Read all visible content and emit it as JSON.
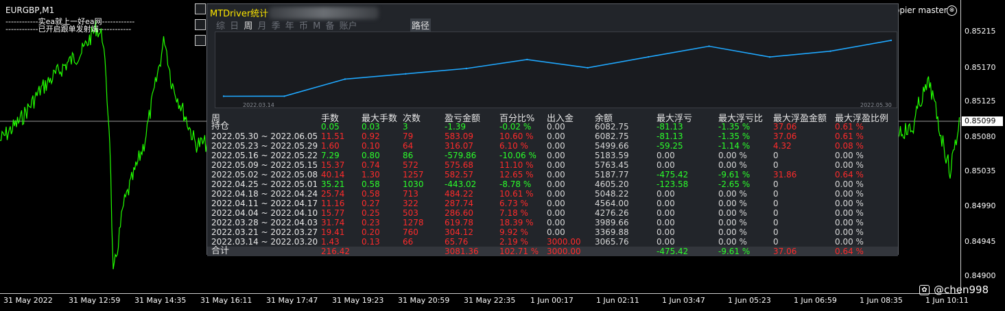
{
  "symbol_title": "EURGBP,M1",
  "comments": [
    "------------实ea就上一好ea网------------",
    "------------已开启跟单发射端------------"
  ],
  "copier": {
    "label": "opier master",
    "close_icon": "⊗"
  },
  "price_axis": {
    "labels": [
      "0.85215",
      "0.85170",
      "0.85125",
      "0.85080",
      "0.85035",
      "0.84990",
      "0.84945",
      "0.84900"
    ],
    "current": "0.85099",
    "range": [
      0.849,
      0.85215
    ]
  },
  "time_axis": [
    "31 May 2022",
    "31 May 12:59",
    "31 May 14:35",
    "31 May 16:11",
    "31 May 17:47",
    "31 May 19:23",
    "31 May 20:59",
    "31 May 22:35",
    "1 Jun 00:17",
    "1 Jun 02:11",
    "1 Jun 03:47",
    "1 Jun 05:23",
    "1 Jun 06:59",
    "1 Jun 08:35",
    "1 Jun 10:11"
  ],
  "watermark": "@chen998",
  "panel": {
    "title": "MTDriver统计",
    "tabs": [
      {
        "label": "综",
        "active": false
      },
      {
        "label": "日",
        "active": false
      },
      {
        "label": "周",
        "active": true
      },
      {
        "label": "月",
        "active": false
      },
      {
        "label": "季",
        "active": false
      },
      {
        "label": "年",
        "active": false
      },
      {
        "label": "币",
        "active": false
      },
      {
        "label": "M",
        "active": false
      },
      {
        "label": "备",
        "active": false
      },
      {
        "label": "账户",
        "active": false
      }
    ],
    "path_tab": "路径",
    "equity": {
      "start_date": "2022.03.14",
      "end_date": "2022.05.30",
      "values": [
        3065.76,
        3069.76,
        3989.66,
        4276.26,
        4564.0,
        5048.22,
        4605.2,
        5187.77,
        5763.45,
        5183.59,
        5499.66,
        6082.75
      ],
      "range": [
        2900,
        6300
      ]
    },
    "headers": [
      "周",
      "手数",
      "最大手数",
      "次数",
      "盈亏金额",
      "百分比%",
      "出入金",
      "余额",
      "最大浮亏",
      "最大浮亏比",
      "最大浮盈金额",
      "最大浮盈比例"
    ],
    "holding": {
      "label": "持仓",
      "cells": [
        {
          "v": "0.05",
          "c": "green"
        },
        {
          "v": "0.03",
          "c": "green"
        },
        {
          "v": "3",
          "c": "green"
        },
        {
          "v": "-1.39",
          "c": "green"
        },
        {
          "v": "-0.02 %",
          "c": "green"
        },
        {
          "v": "0.00",
          "c": "gray"
        },
        {
          "v": "6082.75",
          "c": "gray"
        },
        {
          "v": "-81.13",
          "c": "green"
        },
        {
          "v": "-1.35 %",
          "c": "green"
        },
        {
          "v": "37.06",
          "c": "red"
        },
        {
          "v": "0.61 %",
          "c": "red"
        }
      ]
    },
    "rows": [
      {
        "label": "2022.05.30 ~ 2022.06.05",
        "cells": [
          {
            "v": "11.51",
            "c": "red"
          },
          {
            "v": "0.92",
            "c": "red"
          },
          {
            "v": "79",
            "c": "red"
          },
          {
            "v": "583.09",
            "c": "red"
          },
          {
            "v": "10.60 %",
            "c": "red"
          },
          {
            "v": "0.00",
            "c": "gray"
          },
          {
            "v": "6082.75",
            "c": "gray"
          },
          {
            "v": "-81.13",
            "c": "green"
          },
          {
            "v": "-1.35 %",
            "c": "green"
          },
          {
            "v": "37.06",
            "c": "red"
          },
          {
            "v": "0.61 %",
            "c": "red"
          }
        ]
      },
      {
        "label": "2022.05.23 ~ 2022.05.29",
        "cells": [
          {
            "v": "1.60",
            "c": "red"
          },
          {
            "v": "0.10",
            "c": "red"
          },
          {
            "v": "64",
            "c": "red"
          },
          {
            "v": "316.07",
            "c": "red"
          },
          {
            "v": "6.10 %",
            "c": "red"
          },
          {
            "v": "0.00",
            "c": "gray"
          },
          {
            "v": "5499.66",
            "c": "gray"
          },
          {
            "v": "-59.25",
            "c": "green"
          },
          {
            "v": "-1.14 %",
            "c": "green"
          },
          {
            "v": "4.32",
            "c": "red"
          },
          {
            "v": "0.08 %",
            "c": "red"
          }
        ]
      },
      {
        "label": "2022.05.16 ~ 2022.05.22",
        "cells": [
          {
            "v": "7.29",
            "c": "green"
          },
          {
            "v": "0.80",
            "c": "green"
          },
          {
            "v": "86",
            "c": "green"
          },
          {
            "v": "-579.86",
            "c": "green"
          },
          {
            "v": "-10.06 %",
            "c": "green"
          },
          {
            "v": "0.00",
            "c": "gray"
          },
          {
            "v": "5183.59",
            "c": "gray"
          },
          {
            "v": "0.00",
            "c": "gray"
          },
          {
            "v": "0.00 %",
            "c": "gray"
          },
          {
            "v": "0",
            "c": "gray"
          },
          {
            "v": "0.00 %",
            "c": "gray"
          }
        ]
      },
      {
        "label": "2022.05.09 ~ 2022.05.15",
        "cells": [
          {
            "v": "15.37",
            "c": "red"
          },
          {
            "v": "0.74",
            "c": "red"
          },
          {
            "v": "572",
            "c": "red"
          },
          {
            "v": "575.68",
            "c": "red"
          },
          {
            "v": "11.10 %",
            "c": "red"
          },
          {
            "v": "0.00",
            "c": "gray"
          },
          {
            "v": "5763.45",
            "c": "gray"
          },
          {
            "v": "0.00",
            "c": "gray"
          },
          {
            "v": "0.00 %",
            "c": "gray"
          },
          {
            "v": "0",
            "c": "gray"
          },
          {
            "v": "0.00 %",
            "c": "gray"
          }
        ]
      },
      {
        "label": "2022.05.02 ~ 2022.05.08",
        "cells": [
          {
            "v": "40.14",
            "c": "red"
          },
          {
            "v": "1.30",
            "c": "red"
          },
          {
            "v": "1257",
            "c": "red"
          },
          {
            "v": "582.57",
            "c": "red"
          },
          {
            "v": "12.65 %",
            "c": "red"
          },
          {
            "v": "0.00",
            "c": "gray"
          },
          {
            "v": "5187.77",
            "c": "gray"
          },
          {
            "v": "-475.42",
            "c": "green"
          },
          {
            "v": "-9.61 %",
            "c": "green"
          },
          {
            "v": "31.86",
            "c": "red"
          },
          {
            "v": "0.64 %",
            "c": "red"
          }
        ]
      },
      {
        "label": "2022.04.25 ~ 2022.05.01",
        "cells": [
          {
            "v": "35.21",
            "c": "green"
          },
          {
            "v": "0.58",
            "c": "green"
          },
          {
            "v": "1030",
            "c": "green"
          },
          {
            "v": "-443.02",
            "c": "green"
          },
          {
            "v": "-8.78 %",
            "c": "green"
          },
          {
            "v": "0.00",
            "c": "gray"
          },
          {
            "v": "4605.20",
            "c": "gray"
          },
          {
            "v": "-123.58",
            "c": "green"
          },
          {
            "v": "-2.65 %",
            "c": "green"
          },
          {
            "v": "0",
            "c": "gray"
          },
          {
            "v": "0.00 %",
            "c": "gray"
          }
        ]
      },
      {
        "label": "2022.04.18 ~ 2022.04.24",
        "cells": [
          {
            "v": "25.74",
            "c": "red"
          },
          {
            "v": "0.58",
            "c": "red"
          },
          {
            "v": "713",
            "c": "red"
          },
          {
            "v": "484.22",
            "c": "red"
          },
          {
            "v": "10.61 %",
            "c": "red"
          },
          {
            "v": "0.00",
            "c": "gray"
          },
          {
            "v": "5048.22",
            "c": "gray"
          },
          {
            "v": "0.00",
            "c": "gray"
          },
          {
            "v": "0.00 %",
            "c": "gray"
          },
          {
            "v": "0",
            "c": "gray"
          },
          {
            "v": "0.00 %",
            "c": "gray"
          }
        ]
      },
      {
        "label": "2022.04.11 ~ 2022.04.17",
        "cells": [
          {
            "v": "11.16",
            "c": "red"
          },
          {
            "v": "0.27",
            "c": "red"
          },
          {
            "v": "322",
            "c": "red"
          },
          {
            "v": "287.74",
            "c": "red"
          },
          {
            "v": "6.73 %",
            "c": "red"
          },
          {
            "v": "0.00",
            "c": "gray"
          },
          {
            "v": "4564.00",
            "c": "gray"
          },
          {
            "v": "0.00",
            "c": "gray"
          },
          {
            "v": "0.00 %",
            "c": "gray"
          },
          {
            "v": "0",
            "c": "gray"
          },
          {
            "v": "0.00 %",
            "c": "gray"
          }
        ]
      },
      {
        "label": "2022.04.04 ~ 2022.04.10",
        "cells": [
          {
            "v": "15.77",
            "c": "red"
          },
          {
            "v": "0.25",
            "c": "red"
          },
          {
            "v": "503",
            "c": "red"
          },
          {
            "v": "286.60",
            "c": "red"
          },
          {
            "v": "7.18 %",
            "c": "red"
          },
          {
            "v": "0.00",
            "c": "gray"
          },
          {
            "v": "4276.26",
            "c": "gray"
          },
          {
            "v": "0.00",
            "c": "gray"
          },
          {
            "v": "0.00 %",
            "c": "gray"
          },
          {
            "v": "0",
            "c": "gray"
          },
          {
            "v": "0.00 %",
            "c": "gray"
          }
        ]
      },
      {
        "label": "2022.03.28 ~ 2022.04.03",
        "cells": [
          {
            "v": "31.74",
            "c": "red"
          },
          {
            "v": "0.23",
            "c": "red"
          },
          {
            "v": "1278",
            "c": "red"
          },
          {
            "v": "619.78",
            "c": "red"
          },
          {
            "v": "18.39 %",
            "c": "red"
          },
          {
            "v": "0.00",
            "c": "gray"
          },
          {
            "v": "3989.66",
            "c": "gray"
          },
          {
            "v": "0.00",
            "c": "gray"
          },
          {
            "v": "0.00 %",
            "c": "gray"
          },
          {
            "v": "0",
            "c": "gray"
          },
          {
            "v": "0.00 %",
            "c": "gray"
          }
        ]
      },
      {
        "label": "2022.03.21 ~ 2022.03.27",
        "cells": [
          {
            "v": "19.41",
            "c": "red"
          },
          {
            "v": "0.20",
            "c": "red"
          },
          {
            "v": "760",
            "c": "red"
          },
          {
            "v": "304.12",
            "c": "red"
          },
          {
            "v": "9.92 %",
            "c": "red"
          },
          {
            "v": "0.00",
            "c": "gray"
          },
          {
            "v": "3369.88",
            "c": "gray"
          },
          {
            "v": "0.00",
            "c": "gray"
          },
          {
            "v": "0.00 %",
            "c": "gray"
          },
          {
            "v": "0",
            "c": "gray"
          },
          {
            "v": "0.00 %",
            "c": "gray"
          }
        ]
      },
      {
        "label": "2022.03.14 ~ 2022.03.20",
        "cells": [
          {
            "v": "1.43",
            "c": "red"
          },
          {
            "v": "0.13",
            "c": "red"
          },
          {
            "v": "66",
            "c": "red"
          },
          {
            "v": "65.76",
            "c": "red"
          },
          {
            "v": "2.19 %",
            "c": "red"
          },
          {
            "v": "3000.00",
            "c": "red"
          },
          {
            "v": "3065.76",
            "c": "gray"
          },
          {
            "v": "0.00",
            "c": "gray"
          },
          {
            "v": "0.00 %",
            "c": "gray"
          },
          {
            "v": "0",
            "c": "gray"
          },
          {
            "v": "0.00 %",
            "c": "gray"
          }
        ]
      }
    ],
    "total": {
      "label": "合计",
      "cells": [
        {
          "v": "216.42",
          "c": "red"
        },
        {
          "v": "",
          "c": "red"
        },
        {
          "v": "",
          "c": "red"
        },
        {
          "v": "3081.36",
          "c": "red"
        },
        {
          "v": "102.71 %",
          "c": "red"
        },
        {
          "v": "3000.00",
          "c": "red"
        },
        {
          "v": "",
          "c": "gray"
        },
        {
          "v": "-475.42",
          "c": "green"
        },
        {
          "v": "-9.61 %",
          "c": "green"
        },
        {
          "v": "37.06",
          "c": "red"
        },
        {
          "v": "0.64 %",
          "c": "red"
        }
      ]
    }
  }
}
